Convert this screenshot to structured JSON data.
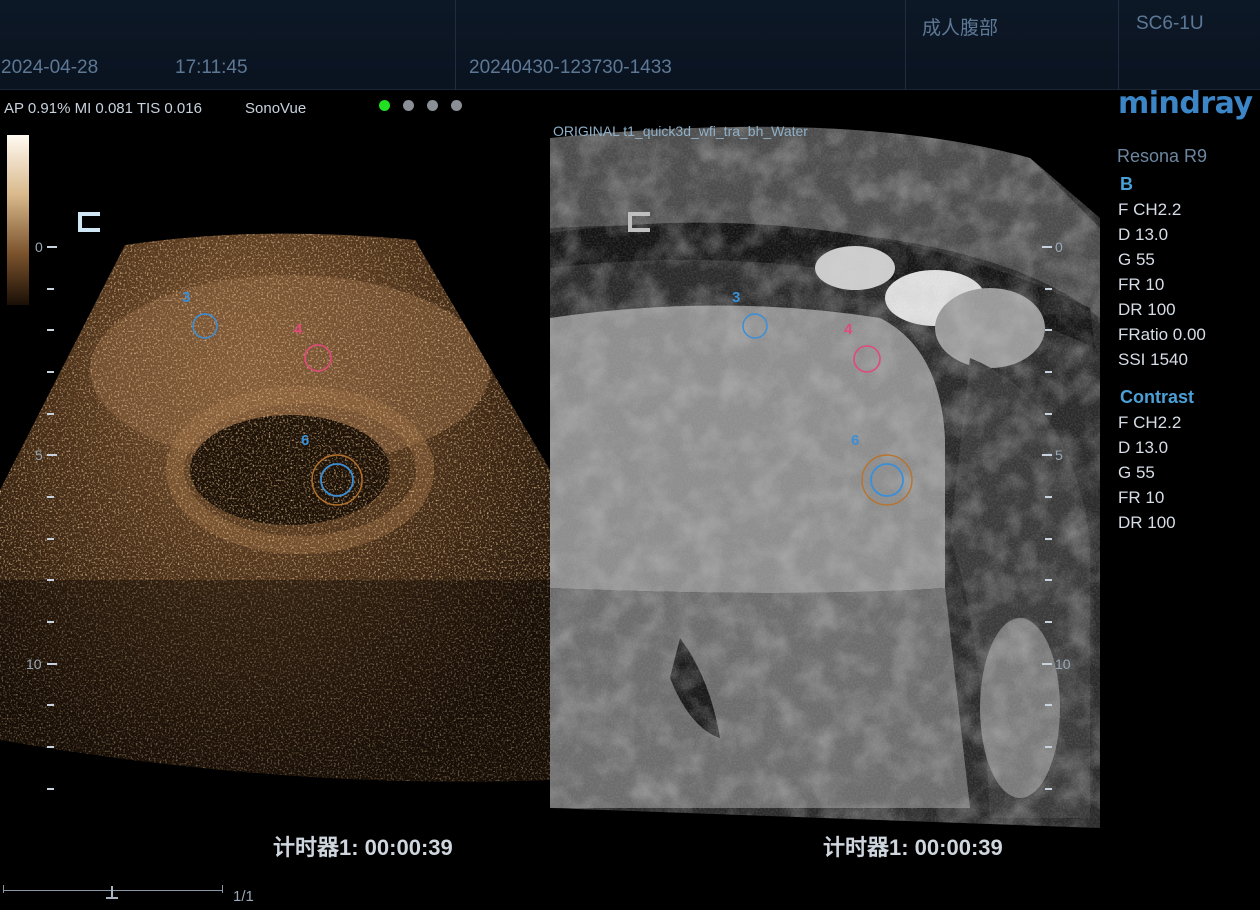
{
  "header": {
    "date": "2024-04-28",
    "time": "17:11:45",
    "exam_id": "20240430-123730-1433",
    "preset": "成人腹部",
    "probe": "SC6-1U"
  },
  "status": {
    "acoustic": "AP 0.91%  MI 0.081 TIS 0.016",
    "agent": "SonoVue"
  },
  "scale": {
    "labels": [
      "0",
      "5",
      "10"
    ]
  },
  "roi_labels": {
    "roi3": "3",
    "roi4": "4",
    "roi6": "6"
  },
  "mr": {
    "title": "ORIGINAL   t1_quick3d_wfi_tra_bh_Water"
  },
  "sidebar": {
    "logo": "mindray",
    "model": "Resona R9",
    "b_title": "B",
    "b_params": [
      "F CH2.2",
      "D 13.0",
      "G 55",
      "FR 10",
      "DR 100",
      "FRatio 0.00",
      "SSI 1540"
    ],
    "contrast_title": "Contrast",
    "contrast_params": [
      "F CH2.2",
      "D 13.0",
      "G 55",
      "FR 10",
      "DR 100"
    ]
  },
  "timer": {
    "left": "计时器1: 00:00:39",
    "right": "计时器1: 00:00:39"
  },
  "cine": {
    "page": "1/1"
  },
  "colors": {
    "roi_blue": "#3a8fd8",
    "roi_pink": "#e04a7c",
    "roi_orange": "#b8732c",
    "accent": "#4aa0d6"
  }
}
